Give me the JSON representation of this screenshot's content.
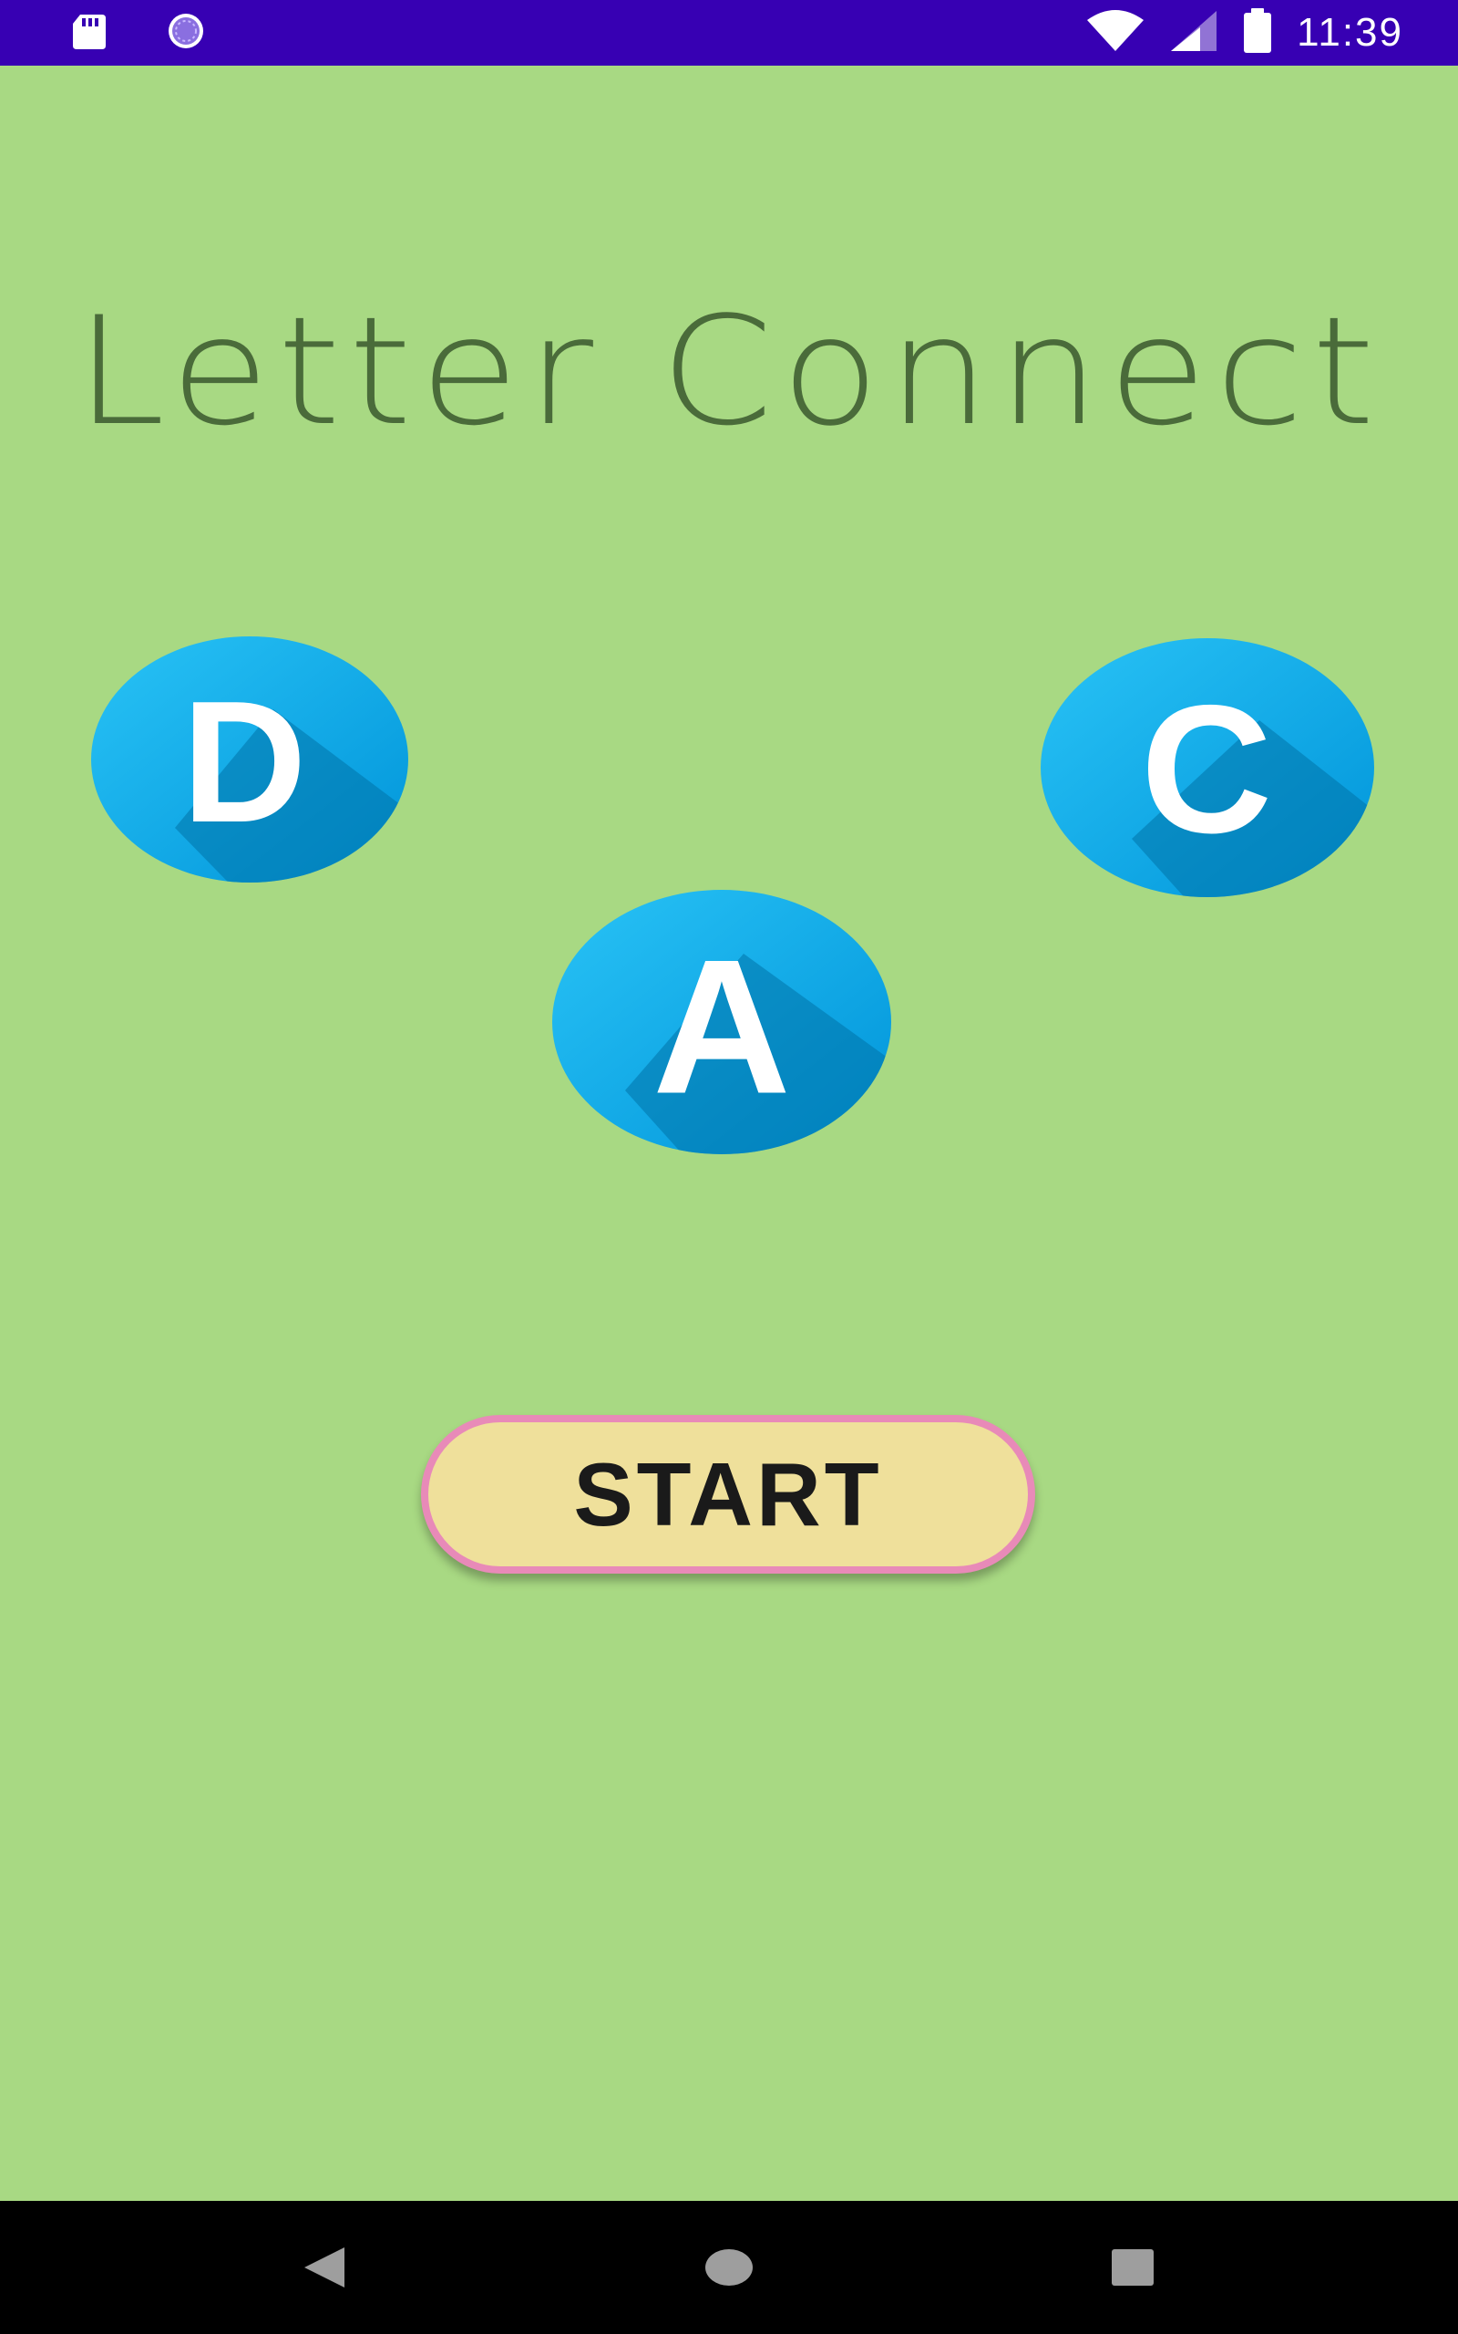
{
  "status_bar": {
    "icons": [
      "sd-card-icon",
      "sync-status-icon",
      "wifi-icon",
      "cellular-signal-icon",
      "battery-icon"
    ],
    "time": "11:39",
    "background": "#3700b3"
  },
  "app": {
    "background": "#a8d983",
    "title": "Letter Connect",
    "title_color": "#4a6b3a",
    "letters": [
      {
        "letter": "D",
        "icon": "letter-d-icon"
      },
      {
        "letter": "C",
        "icon": "letter-c-icon"
      },
      {
        "letter": "A",
        "icon": "letter-a-icon"
      }
    ],
    "badge_colors": {
      "light": "#29c3f6",
      "dark": "#0094d9",
      "shadow": "#0073a8",
      "glyph": "#ffffff"
    },
    "start_button": {
      "label": "START",
      "fill": "#efe09b",
      "border": "#e88ab8"
    }
  },
  "nav_bar": {
    "buttons": [
      "back-icon",
      "home-icon",
      "recents-icon"
    ],
    "icon_color": "#9e9e9e"
  }
}
